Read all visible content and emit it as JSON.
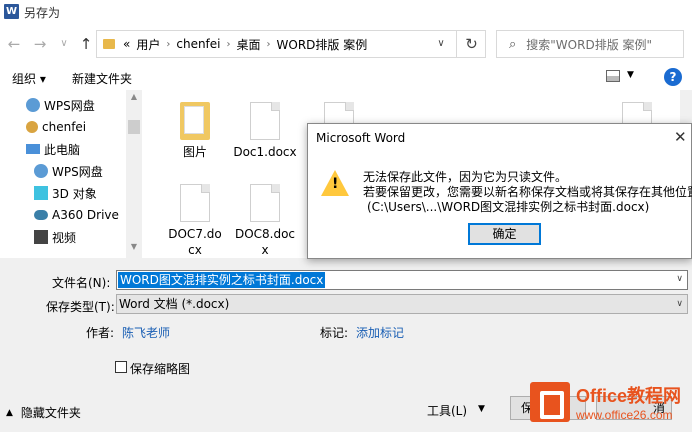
{
  "window": {
    "title": "另存为",
    "app_logo_letter": "W"
  },
  "nav": {
    "back": "←",
    "forward": "→",
    "dropdown": "∨",
    "up": "↑",
    "breadcrumb": [
      "用户",
      "chenfei",
      "桌面",
      "WORD排版 案例"
    ],
    "breadcrumb_prefix": "«",
    "search_placeholder": "搜索\"WORD排版 案例\""
  },
  "toolbar": {
    "organize": "组织 ▾",
    "new_folder": "新建文件夹",
    "help": "?"
  },
  "sidebar": {
    "items": [
      {
        "label": "WPS网盘",
        "icon": "cloud-icon"
      },
      {
        "label": "chenfei",
        "icon": "user-icon"
      },
      {
        "label": "此电脑",
        "icon": "computer-icon"
      },
      {
        "label": "WPS网盘",
        "icon": "cloud-icon"
      },
      {
        "label": "3D 对象",
        "icon": "cube-icon"
      },
      {
        "label": "A360 Drive",
        "icon": "drive-icon"
      },
      {
        "label": "视频",
        "icon": "video-icon"
      }
    ]
  },
  "files": [
    {
      "name": "图片",
      "type": "folder"
    },
    {
      "name": "Doc1.docx",
      "type": "doc"
    },
    {
      "name": "DOC7.docx",
      "type": "doc"
    },
    {
      "name": "DOC8.docx",
      "type": "doc"
    }
  ],
  "form": {
    "filename_label": "文件名(N):",
    "filename_value": "WORD图文混排实例之标书封面.docx",
    "type_label": "保存类型(T):",
    "type_value": "Word 文档 (*.docx)",
    "author_label": "作者:",
    "author_value": "陈飞老师",
    "tags_label": "标记:",
    "tags_value": "添加标记",
    "thumbnail_label": "保存缩略图",
    "hide_folders": "隐藏文件夹",
    "tools": "工具(L)",
    "save": "保",
    "cancel": "消"
  },
  "dialog": {
    "title": "Microsoft Word",
    "line1": "无法保存此文件，因为它为只读文件。",
    "line2": "若要保留更改，您需要以新名称保存文档或将其保存在其他位置。",
    "line3": "(C:\\Users\\...\\WORD图文混排实例之标书封面.docx)",
    "ok": "确定",
    "close": "✕"
  },
  "watermark": {
    "title": "Office教程网",
    "url": "www.office26.com"
  },
  "colors": {
    "accent": "#0078d7",
    "warning": "#ffc83d",
    "link": "#1a5fb4",
    "brand": "#e8531e"
  }
}
